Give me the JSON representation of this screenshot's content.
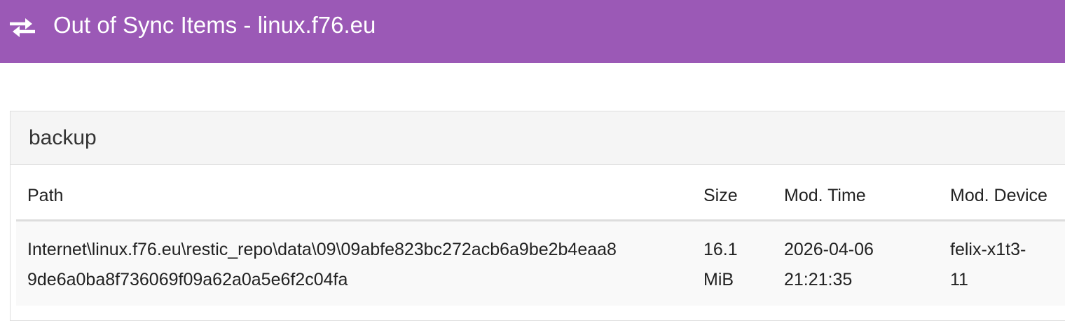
{
  "header": {
    "icon": "sync-arrows-icon",
    "title": "Out of Sync Items - linux.f76.eu"
  },
  "folder": {
    "name": "backup",
    "columns": {
      "path": "Path",
      "size": "Size",
      "mod_time": "Mod. Time",
      "mod_device": "Mod. Device"
    },
    "rows": [
      {
        "path_line1": "Internet\\linux.f76.eu\\restic_repo\\data\\09\\09abfe823bc272acb6a9be2b4eaa8",
        "path_line2": "9de6a0ba8f736069f09a62a0a5e6f2c04fa",
        "size_line1": "16.1",
        "size_line2": "MiB",
        "time_line1": "2026-04-06",
        "time_line2": "21:21:35",
        "device_line1": "felix-x1t3-",
        "device_line2": "11"
      }
    ]
  },
  "colors": {
    "header_bg": "#9b59b6",
    "panel_heading_bg": "#f5f5f5",
    "row_bg": "#f9f9f9"
  }
}
